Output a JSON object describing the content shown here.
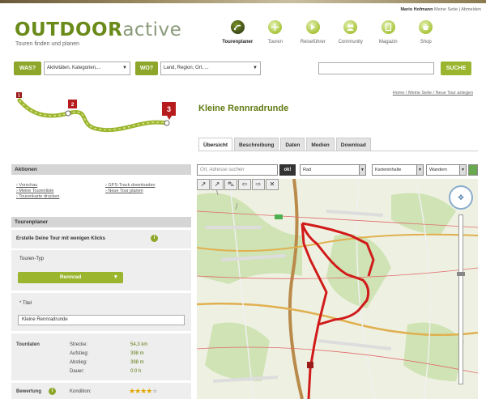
{
  "header": {
    "user_name": "Mario Hofmann",
    "user_links": "Meine Seite | Abmelden",
    "logo_part1": "OUTDOOR",
    "logo_part2": "active",
    "tagline": "Touren finden und planen"
  },
  "nav": {
    "items": [
      {
        "label": "Tourenplaner",
        "icon": "route-icon",
        "active": true
      },
      {
        "label": "Touren",
        "icon": "tours-icon",
        "active": false
      },
      {
        "label": "Reiseführer",
        "icon": "guide-icon",
        "active": false
      },
      {
        "label": "Community",
        "icon": "community-icon",
        "active": false
      },
      {
        "label": "Magazin",
        "icon": "magazine-icon",
        "active": false
      },
      {
        "label": "Shop",
        "icon": "shop-icon",
        "active": false
      }
    ]
  },
  "search": {
    "was_label": "WAS?",
    "was_value": "Aktivitäten, Kategorien,...",
    "wo_label": "WO?",
    "wo_value": "Land, Region, Ort, ...",
    "query": "",
    "button": "SUCHE"
  },
  "breadcrumb": "Home / Meine Seite / Neue Tour anlegen",
  "route_markers": [
    "1",
    "2",
    "3"
  ],
  "tour": {
    "title": "Kleine Rennradrunde"
  },
  "tabs": [
    "Übersicht",
    "Beschreibung",
    "Daten",
    "Medien",
    "Download"
  ],
  "sidebar": {
    "aktionen": {
      "title": "Aktionen",
      "links_left": [
        "Vorschau",
        "Meine Tourenliste",
        "Tourenkarte drucken"
      ],
      "links_right": [
        "GPS-Track downloaden",
        "Neue Tour planen"
      ]
    },
    "planer": {
      "title": "Tourenplaner",
      "hint": "Erstelle Deine Tour mit wenigen Klicks",
      "type_label": "Touren-Typ",
      "type_value": "Rennrad",
      "title_label": "* Titel",
      "title_value": "Kleine Rennradrunde"
    },
    "tourdaten": {
      "label": "Tourdaten",
      "rows": [
        {
          "label": "Strecke:",
          "value": "54,3 km"
        },
        {
          "label": "Aufstieg:",
          "value": "398 m"
        },
        {
          "label": "Abstieg:",
          "value": "398 m"
        },
        {
          "label": "Dauer:",
          "value": "0:0 h"
        }
      ]
    },
    "bewertung": {
      "label": "Bewertung",
      "sub": "Kondition:",
      "stars": 4
    }
  },
  "map": {
    "search_placeholder": "Ort, Adresse suchen",
    "ok_label": "ok!",
    "profile_value": "Rad",
    "inhalt_value": "Karteninhalte",
    "wandern_value": "Wandern"
  },
  "colors": {
    "brand_green": "#8ea62a",
    "title_green": "#5f7a12",
    "route_red": "#d11a1a"
  }
}
